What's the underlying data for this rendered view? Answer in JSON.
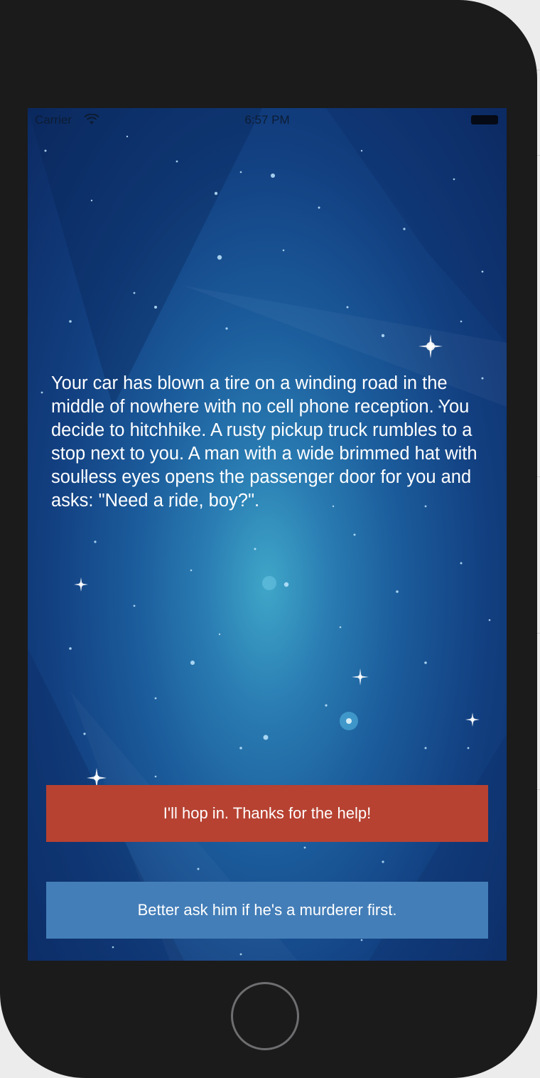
{
  "status_bar": {
    "carrier": "Carrier",
    "time": "6:57 PM",
    "wifi_icon": "wifi-icon",
    "battery_icon": "battery-full-icon"
  },
  "story": {
    "text": "Your car has blown a tire on a winding road in the middle of nowhere with no cell phone reception. You decide to hitchhike. A rusty pickup truck rumbles to a stop next to you. A man with a wide brimmed hat with soulless eyes opens the passenger door for you and asks: \"Need a ride, boy?\"."
  },
  "choices": [
    {
      "label": "I'll hop in. Thanks for the help!",
      "color": "#b74232"
    },
    {
      "label": "Better ask him if he's a murderer first.",
      "color": "#437eb8"
    }
  ],
  "device": {
    "home_button_icon": "home-button-icon"
  }
}
